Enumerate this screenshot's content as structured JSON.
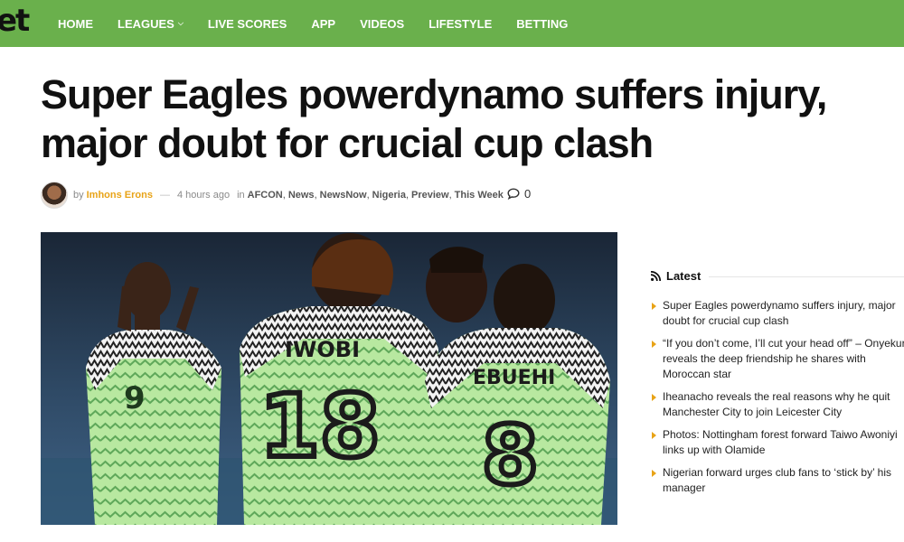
{
  "site": {
    "logo_text": "et",
    "accent_color": "#6ab04c",
    "author_color": "#e8a317"
  },
  "nav": {
    "items": [
      {
        "label": "HOME"
      },
      {
        "label": "LEAGUES",
        "has_dropdown": true
      },
      {
        "label": "LIVE SCORES"
      },
      {
        "label": "APP"
      },
      {
        "label": "VIDEOS"
      },
      {
        "label": "LIFESTYLE"
      },
      {
        "label": "BETTING"
      }
    ]
  },
  "article": {
    "title": "Super Eagles powerdynamo suffers injury, major doubt for crucial cup clash",
    "by": "by",
    "author": "Imhons Erons",
    "dash": "—",
    "time": "4 hours ago",
    "in": "in",
    "categories": [
      "AFCON",
      "News",
      "NewsNow",
      "Nigeria",
      "Preview",
      "This Week"
    ],
    "comment_count": "0",
    "hero_players": [
      {
        "name": "",
        "number": "9"
      },
      {
        "name": "IWOBI",
        "number": "18"
      },
      {
        "name": "EBUEHI",
        "number": "8"
      }
    ]
  },
  "sidebar": {
    "latest_title": "Latest",
    "items": [
      "Super Eagles powerdynamo suffers injury, major doubt for crucial cup clash",
      "“If you don’t come, I’ll cut your head off” – Onyekuru reveals the deep friendship he shares with Moroccan star",
      "Iheanacho reveals the real reasons why he quit Manchester City to join Leicester City",
      "Photos: Nottingham forest forward Taiwo Awoniyi links up with Olamide",
      "Nigerian forward urges club fans to ‘stick by’ his manager"
    ]
  }
}
